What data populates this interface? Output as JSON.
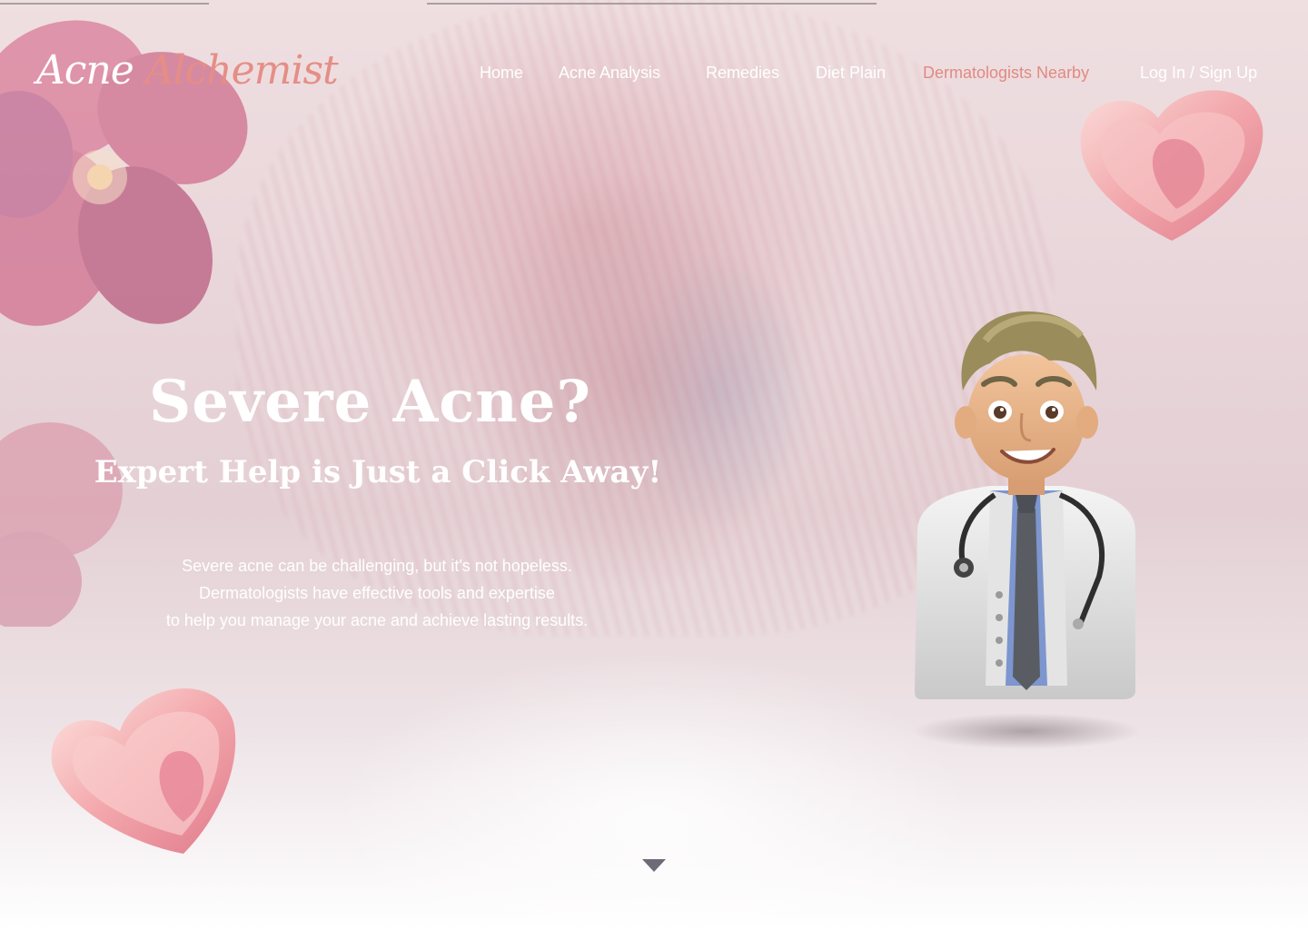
{
  "brand": {
    "logo_part1": "Acne ",
    "logo_part2": "Alchemist",
    "accent_color": "#e58e86"
  },
  "nav": {
    "items": [
      {
        "label": "Home"
      },
      {
        "label": "Acne Analysis"
      },
      {
        "label": "Remedies"
      },
      {
        "label": "Diet Plain"
      },
      {
        "label": "Dermatologists Nearby",
        "active": true
      },
      {
        "label": "Log In / Sign Up"
      }
    ]
  },
  "hero": {
    "title": "Severe Acne?",
    "subtitle": "Expert Help is Just a Click Away!",
    "description": [
      "Severe acne can be challenging, but it's not hopeless.",
      "Dermatologists have effective tools and expertise",
      "to help you manage your acne and achieve lasting results."
    ]
  },
  "icons": {
    "scroll": "chevron-down-icon",
    "doctor": "doctor-avatar-illustration",
    "heart": "heart-3d-illustration",
    "flower": "flower-illustration"
  }
}
